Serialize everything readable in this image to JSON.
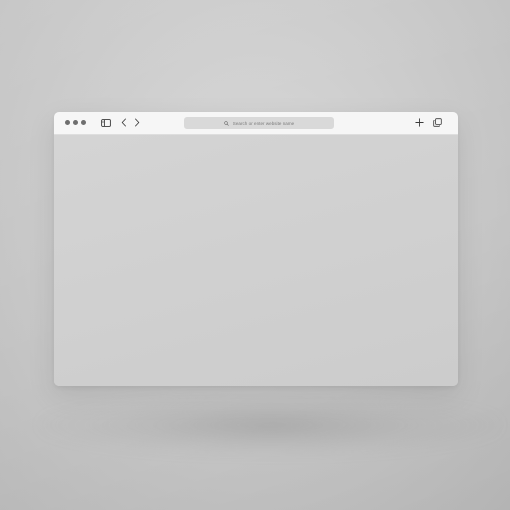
{
  "browser": {
    "address_bar": {
      "placeholder": "Search or enter website name"
    },
    "toolbar": {
      "icons": [
        "window-dot-icon",
        "window-dot-icon",
        "window-dot-icon",
        "sidebar-icon",
        "back-chevron-icon",
        "forward-chevron-icon",
        "search-icon",
        "plus-icon",
        "tabs-overview-icon"
      ]
    },
    "colors": {
      "toolbar": "#f6f6f6",
      "address_bar": "#d9d9d9",
      "content": "#d2d2d2",
      "icon": "#3a3a3a",
      "dots": "#6e6e6e",
      "background": "#c9c9c9"
    }
  }
}
